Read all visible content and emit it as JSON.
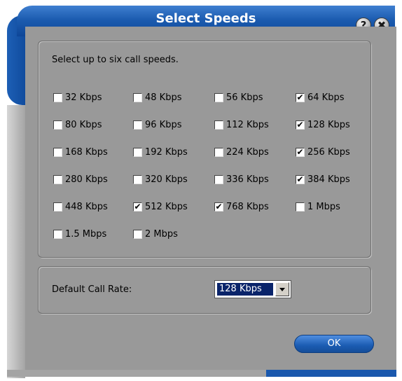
{
  "window": {
    "title": "Select Speeds",
    "help_glyph": "?",
    "close_glyph": "✖"
  },
  "instruction": "Select up to six call speeds.",
  "speeds": [
    {
      "label": "32 Kbps",
      "checked": false
    },
    {
      "label": "48 Kbps",
      "checked": false
    },
    {
      "label": "56 Kbps",
      "checked": false
    },
    {
      "label": "64 Kbps",
      "checked": true
    },
    {
      "label": "80 Kbps",
      "checked": false
    },
    {
      "label": "96 Kbps",
      "checked": false
    },
    {
      "label": "112 Kbps",
      "checked": false
    },
    {
      "label": "128 Kbps",
      "checked": true
    },
    {
      "label": "168 Kbps",
      "checked": false
    },
    {
      "label": "192 Kbps",
      "checked": false
    },
    {
      "label": "224 Kbps",
      "checked": false
    },
    {
      "label": "256 Kbps",
      "checked": true
    },
    {
      "label": "280 Kbps",
      "checked": false
    },
    {
      "label": "320 Kbps",
      "checked": false
    },
    {
      "label": "336 Kbps",
      "checked": false
    },
    {
      "label": "384 Kbps",
      "checked": true
    },
    {
      "label": "448 Kbps",
      "checked": false
    },
    {
      "label": "512 Kbps",
      "checked": true
    },
    {
      "label": "768 Kbps",
      "checked": true
    },
    {
      "label": "1 Mbps",
      "checked": false
    },
    {
      "label": "1.5 Mbps",
      "checked": false
    },
    {
      "label": "2 Mbps",
      "checked": false
    }
  ],
  "default_rate": {
    "label": "Default Call Rate:",
    "value": "128 Kbps"
  },
  "ok_label": "OK",
  "check_glyph": "✔",
  "colors": {
    "title_bar": "#1c5cb0",
    "body": "#999999",
    "selection": "#0a246a"
  }
}
